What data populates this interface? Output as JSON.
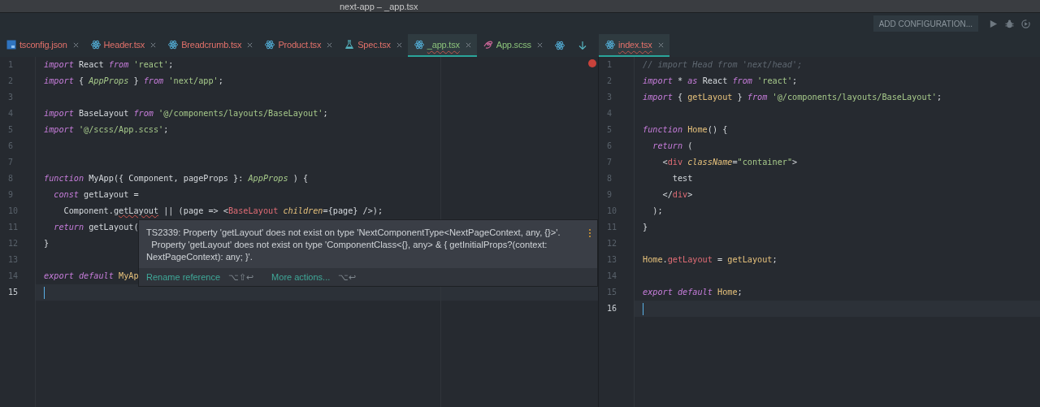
{
  "window": {
    "title": "next-app – _app.tsx"
  },
  "toolbar": {
    "run_config": "ADD CONFIGURATION..."
  },
  "left_tabs": [
    {
      "label": "tsconfig.json",
      "kind": "ts",
      "color": "#e2716a",
      "selected": false
    },
    {
      "label": "Header.tsx",
      "kind": "react",
      "color": "#e2716a",
      "selected": false
    },
    {
      "label": "Breadcrumb.tsx",
      "kind": "react",
      "color": "#e2716a",
      "selected": false
    },
    {
      "label": "Product.tsx",
      "kind": "react",
      "color": "#e2716a",
      "selected": false
    },
    {
      "label": "Spec.tsx",
      "kind": "flask",
      "color": "#e2716a",
      "selected": false
    },
    {
      "label": "_app.tsx",
      "kind": "react",
      "color": "#8bc27a",
      "selected": true
    },
    {
      "label": "App.scss",
      "kind": "sass",
      "color": "#8bc27a",
      "selected": false
    }
  ],
  "right_tabs": [
    {
      "label": "index.tsx",
      "kind": "react",
      "color": "#e2716a",
      "selected": true
    }
  ],
  "left_editor": {
    "has_error": true,
    "lines": [
      {
        "number": "1",
        "current": false,
        "tokens": [
          {
            "kind": "kw",
            "text": "import"
          },
          {
            "kind": "pl",
            "text": " React "
          },
          {
            "kind": "kw",
            "text": "from "
          },
          {
            "kind": "str",
            "text": "'react'"
          },
          {
            "kind": "pl",
            "text": ";"
          }
        ]
      },
      {
        "number": "2",
        "current": false,
        "tokens": [
          {
            "kind": "kw",
            "text": "import"
          },
          {
            "kind": "pl",
            "text": " { "
          },
          {
            "kind": "type",
            "text": "AppProps"
          },
          {
            "kind": "pl",
            "text": " } "
          },
          {
            "kind": "kw",
            "text": "from "
          },
          {
            "kind": "str",
            "text": "'next/app'"
          },
          {
            "kind": "pl",
            "text": ";"
          }
        ]
      },
      {
        "number": "3",
        "current": false
      },
      {
        "number": "4",
        "current": false,
        "tokens": [
          {
            "kind": "kw",
            "text": "import"
          },
          {
            "kind": "pl",
            "text": " BaseLayout "
          },
          {
            "kind": "kw",
            "text": "from "
          },
          {
            "kind": "str",
            "text": "'@/components/layouts/BaseLayout'"
          },
          {
            "kind": "pl",
            "text": ";"
          }
        ]
      },
      {
        "number": "5",
        "current": false,
        "tokens": [
          {
            "kind": "kw",
            "text": "import "
          },
          {
            "kind": "str",
            "text": "'@/scss/App.scss'"
          },
          {
            "kind": "pl",
            "text": ";"
          }
        ]
      },
      {
        "number": "6",
        "current": false
      },
      {
        "number": "7",
        "current": false
      },
      {
        "number": "8",
        "current": false,
        "tokens": [
          {
            "kind": "kw",
            "text": "function"
          },
          {
            "kind": "pl",
            "text": " MyApp({ Component, pageProps }: "
          },
          {
            "kind": "type",
            "text": "AppProps"
          },
          {
            "kind": "pl",
            "text": " ) {"
          }
        ]
      },
      {
        "number": "9",
        "current": false,
        "tokens": [
          {
            "kind": "kw",
            "text": "  const"
          },
          {
            "kind": "pl",
            "text": " getLayout ="
          }
        ]
      },
      {
        "number": "10",
        "current": false,
        "tokens": [
          {
            "kind": "pl",
            "text": "    Component."
          },
          {
            "kind": "err",
            "text": "getLayout"
          },
          {
            "kind": "pl",
            "text": " || (page => <"
          },
          {
            "kind": "tag",
            "text": "BaseLayout"
          },
          {
            "kind": "attr",
            "text": " children"
          },
          {
            "kind": "pl",
            "text": "={page} />);"
          }
        ]
      },
      {
        "number": "11",
        "current": false,
        "tokens": [
          {
            "kind": "kw",
            "text": "  return"
          },
          {
            "kind": "pl",
            "text": " getLayout("
          }
        ]
      },
      {
        "number": "12",
        "current": false,
        "tokens": [
          {
            "kind": "pl",
            "text": "}"
          }
        ]
      },
      {
        "number": "13",
        "current": false
      },
      {
        "number": "14",
        "current": false,
        "tokens": [
          {
            "kind": "kw",
            "text": "export default "
          },
          {
            "kind": "fn",
            "text": "MyAp"
          }
        ]
      },
      {
        "number": "15",
        "current": true
      }
    ]
  },
  "right_editor": {
    "lines": [
      {
        "number": "1",
        "current": false,
        "tokens": [
          {
            "kind": "cm",
            "text": "// import Head from 'next/head';"
          }
        ]
      },
      {
        "number": "2",
        "current": false,
        "tokens": [
          {
            "kind": "kw",
            "text": "import"
          },
          {
            "kind": "pl",
            "text": " * "
          },
          {
            "kind": "kw",
            "text": "as"
          },
          {
            "kind": "pl",
            "text": " React "
          },
          {
            "kind": "kw",
            "text": "from "
          },
          {
            "kind": "str",
            "text": "'react'"
          },
          {
            "kind": "pl",
            "text": ";"
          }
        ]
      },
      {
        "number": "3",
        "current": false,
        "tokens": [
          {
            "kind": "kw",
            "text": "import"
          },
          {
            "kind": "pl",
            "text": " { "
          },
          {
            "kind": "fn",
            "text": "getLayout"
          },
          {
            "kind": "pl",
            "text": " } "
          },
          {
            "kind": "kw",
            "text": "from "
          },
          {
            "kind": "str",
            "text": "'@/components/layouts/BaseLayout'"
          },
          {
            "kind": "pl",
            "text": ";"
          }
        ]
      },
      {
        "number": "4",
        "current": false
      },
      {
        "number": "5",
        "current": false,
        "tokens": [
          {
            "kind": "kw",
            "text": "function "
          },
          {
            "kind": "fn",
            "text": "Home"
          },
          {
            "kind": "pl",
            "text": "() {"
          }
        ]
      },
      {
        "number": "6",
        "current": false,
        "tokens": [
          {
            "kind": "kw",
            "text": "  return"
          },
          {
            "kind": "pl",
            "text": " ("
          }
        ]
      },
      {
        "number": "7",
        "current": false,
        "tokens": [
          {
            "kind": "pl",
            "text": "    <"
          },
          {
            "kind": "tag",
            "text": "div"
          },
          {
            "kind": "attr",
            "text": " className"
          },
          {
            "kind": "pl",
            "text": "="
          },
          {
            "kind": "str",
            "text": "\"container\""
          },
          {
            "kind": "pl",
            "text": ">"
          }
        ]
      },
      {
        "number": "8",
        "current": false,
        "tokens": [
          {
            "kind": "pl",
            "text": "      test"
          }
        ]
      },
      {
        "number": "9",
        "current": false,
        "tokens": [
          {
            "kind": "pl",
            "text": "    </"
          },
          {
            "kind": "tag",
            "text": "div"
          },
          {
            "kind": "pl",
            "text": ">"
          }
        ]
      },
      {
        "number": "10",
        "current": false,
        "tokens": [
          {
            "kind": "pl",
            "text": "  );"
          }
        ]
      },
      {
        "number": "11",
        "current": false,
        "tokens": [
          {
            "kind": "pl",
            "text": "}"
          }
        ]
      },
      {
        "number": "12",
        "current": false
      },
      {
        "number": "13",
        "current": false,
        "tokens": [
          {
            "kind": "fn",
            "text": "Home"
          },
          {
            "kind": "pl",
            "text": "."
          },
          {
            "kind": "prop",
            "text": "getLayout"
          },
          {
            "kind": "pl",
            "text": " = "
          },
          {
            "kind": "fn",
            "text": "getLayout"
          },
          {
            "kind": "pl",
            "text": ";"
          }
        ]
      },
      {
        "number": "14",
        "current": false
      },
      {
        "number": "15",
        "current": false,
        "tokens": [
          {
            "kind": "kw",
            "text": "export default "
          },
          {
            "kind": "fn",
            "text": "Home"
          },
          {
            "kind": "pl",
            "text": ";"
          }
        ]
      },
      {
        "number": "16",
        "current": true
      }
    ]
  },
  "error_popup": {
    "messages": [
      "TS2339: Property 'getLayout' does not exist on type 'NextComponentType<NextPageContext, any, {}>'.",
      "  Property 'getLayout' does not exist on type 'ComponentClass<{}, any> & { getInitialProps?(context: NextPageContext): any; }'."
    ],
    "actions": [
      {
        "label": "Rename reference",
        "shortcut": "⌥⇧↩"
      },
      {
        "label": "More actions...",
        "shortcut": "⌥↩"
      }
    ]
  }
}
